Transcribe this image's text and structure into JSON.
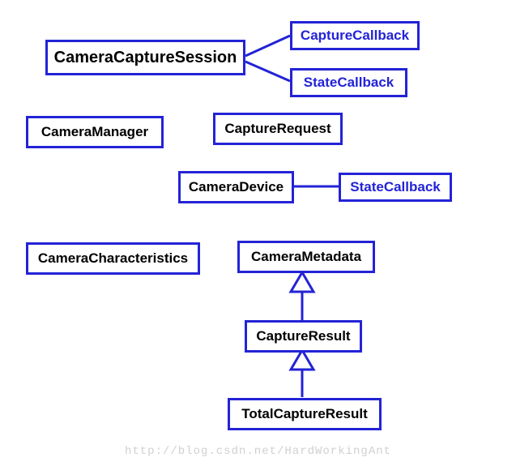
{
  "chart_data": {
    "type": "diagram",
    "title": "",
    "nodes": [
      {
        "id": "camera_capture_session",
        "label": "CameraCaptureSession",
        "color": "black"
      },
      {
        "id": "capture_callback",
        "label": "CaptureCallback",
        "color": "blue"
      },
      {
        "id": "state_callback_session",
        "label": "StateCallback",
        "color": "blue"
      },
      {
        "id": "camera_manager",
        "label": "CameraManager",
        "color": "black"
      },
      {
        "id": "capture_request",
        "label": "CaptureRequest",
        "color": "black"
      },
      {
        "id": "camera_device",
        "label": "CameraDevice",
        "color": "black"
      },
      {
        "id": "state_callback_device",
        "label": "StateCallback",
        "color": "blue"
      },
      {
        "id": "camera_characteristics",
        "label": "CameraCharacteristics",
        "color": "black"
      },
      {
        "id": "camera_metadata",
        "label": "CameraMetadata",
        "color": "black"
      },
      {
        "id": "capture_result",
        "label": "CaptureResult",
        "color": "black"
      },
      {
        "id": "total_capture_result",
        "label": "TotalCaptureResult",
        "color": "black"
      }
    ],
    "edges": [
      {
        "from": "camera_capture_session",
        "to": "capture_callback",
        "style": "line"
      },
      {
        "from": "camera_capture_session",
        "to": "state_callback_session",
        "style": "line"
      },
      {
        "from": "camera_device",
        "to": "state_callback_device",
        "style": "line"
      },
      {
        "from": "capture_result",
        "to": "camera_metadata",
        "style": "hollow-arrow"
      },
      {
        "from": "total_capture_result",
        "to": "capture_result",
        "style": "hollow-arrow"
      }
    ]
  },
  "labels": {
    "camera_capture_session": "CameraCaptureSession",
    "capture_callback": "CaptureCallback",
    "state_callback_session": "StateCallback",
    "camera_manager": "CameraManager",
    "capture_request": "CaptureRequest",
    "camera_device": "CameraDevice",
    "state_callback_device": "StateCallback",
    "camera_characteristics": "CameraCharacteristics",
    "camera_metadata": "CameraMetadata",
    "capture_result": "CaptureResult",
    "total_capture_result": "TotalCaptureResult"
  },
  "watermark": "http://blog.csdn.net/HardWorkingAnt"
}
